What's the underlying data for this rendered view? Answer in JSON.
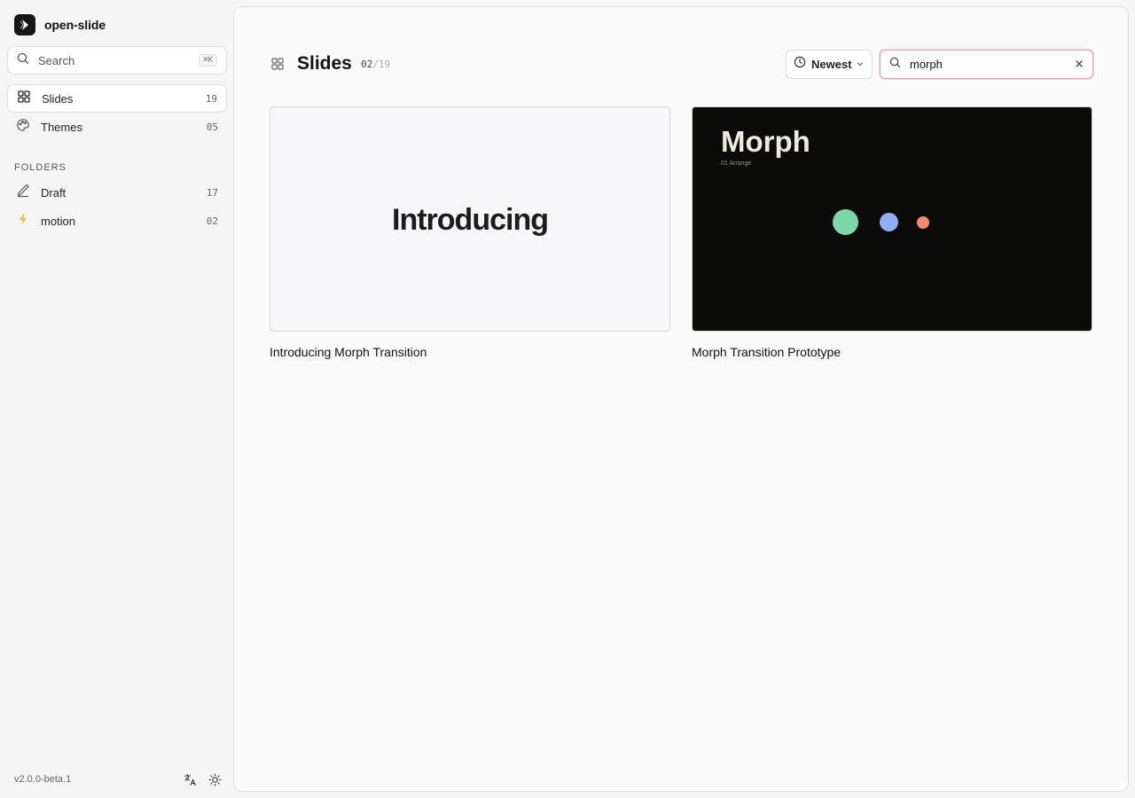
{
  "app": {
    "name": "open-slide",
    "version": "v2.0.0-beta.1"
  },
  "search": {
    "label": "Search",
    "shortcut": "⌘K"
  },
  "nav": [
    {
      "label": "Slides",
      "count": "19",
      "icon": "grid-icon",
      "active": true
    },
    {
      "label": "Themes",
      "count": "05",
      "icon": "palette-icon",
      "active": false
    }
  ],
  "folders": {
    "heading": "FOLDERS",
    "items": [
      {
        "label": "Draft",
        "count": "17",
        "icon": "pencil-icon"
      },
      {
        "label": "motion",
        "count": "02",
        "icon": "lightning-icon"
      }
    ]
  },
  "header": {
    "title": "Slides",
    "shown": "02",
    "total": "/19"
  },
  "sort": {
    "label": "Newest",
    "icon": "clock-icon"
  },
  "filter": {
    "value": "morph",
    "icon": "search-icon"
  },
  "cards": [
    {
      "title": "Introducing Morph Transition",
      "thumbnail_text": "Introducing",
      "theme": "light"
    },
    {
      "title": "Morph Transition Prototype",
      "thumbnail_title": "Morph",
      "thumbnail_subtitle": "01 Arrange",
      "theme": "dark",
      "dot_colors": [
        "#7bd9a8",
        "#8eaef8",
        "#f58a6a"
      ]
    }
  ],
  "colors": {
    "accent_border": "#e2a5ad",
    "lightning": "#f5c04a"
  }
}
